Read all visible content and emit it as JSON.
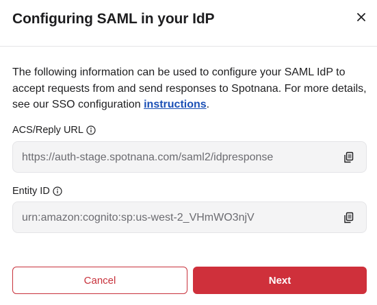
{
  "modal": {
    "title": "Configuring SAML in your IdP",
    "close_icon": "close-icon"
  },
  "description": {
    "text": "The following information can be used to configure your SAML IdP to accept requests from and send responses to Spotnana. For more details, see our SSO configuration ",
    "link_text": "instructions",
    "suffix": "."
  },
  "fields": {
    "acs": {
      "label": "ACS/Reply URL",
      "value": "https://auth-stage.spotnana.com/saml2/idpresponse",
      "info_icon": "info-icon",
      "copy_icon": "copy-icon"
    },
    "entity": {
      "label": "Entity ID",
      "value": "urn:amazon:cognito:sp:us-west-2_VHmWO3njV",
      "info_icon": "info-icon",
      "copy_icon": "copy-icon"
    }
  },
  "footer": {
    "cancel_label": "Cancel",
    "next_label": "Next"
  },
  "colors": {
    "accent": "#cf303b",
    "link": "#1a4fb5"
  }
}
